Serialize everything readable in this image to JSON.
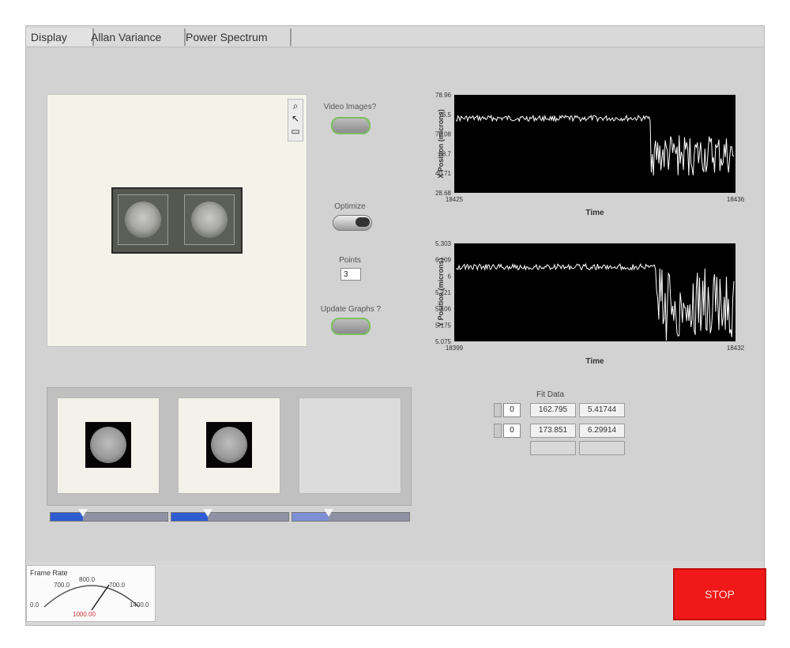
{
  "tabs": [
    {
      "label": "Display",
      "active": true
    },
    {
      "label": "Allan Variance",
      "active": false
    },
    {
      "label": "Power Spectrum",
      "active": false
    }
  ],
  "image_panel": {
    "tools": [
      "zoom-icon",
      "pointer-icon",
      "pan-icon"
    ]
  },
  "controls": {
    "video_images_label": "Video Images?",
    "optimize_label": "Optimize",
    "points_label": "Points",
    "points_value": "3",
    "update_graphs_label": "Update Graphs ?"
  },
  "chart_data": [
    {
      "type": "line",
      "title": "",
      "xlabel": "Time",
      "ylabel": "X Position (microns)",
      "x_tick_labels": [
        "18425",
        "18436"
      ],
      "y_tick_labels": [
        "28.68",
        "40.71",
        "58.7",
        "70.08",
        "76.5",
        "78.96"
      ],
      "grid": false,
      "background": "#000000",
      "line_color": "#ffffff"
    },
    {
      "type": "line",
      "title": "",
      "xlabel": "Time",
      "ylabel": "Y Position (microns)",
      "x_tick_labels": [
        "18399",
        "18432"
      ],
      "y_tick_labels": [
        "5.075",
        "5.175",
        "5.106",
        "5.221",
        "6",
        "6.109",
        "5.303"
      ],
      "grid": false,
      "background": "#000000",
      "line_color": "#ffffff"
    }
  ],
  "fit_table": {
    "title": "Fit Data",
    "rows": [
      {
        "index": "0",
        "values": [
          "162.795",
          "5.41744"
        ]
      },
      {
        "index": "0",
        "values": [
          "173.851",
          "6.29914"
        ]
      }
    ]
  },
  "thumbnails": [
    {
      "state": "image",
      "slider_fraction": 0.28
    },
    {
      "state": "image",
      "slider_fraction": 0.31
    },
    {
      "state": "empty",
      "slider_fraction": 0.31
    }
  ],
  "gauge": {
    "title": "Frame Rate",
    "ticks": [
      "0.0",
      "700.0",
      "800.0",
      "700.0",
      "1400.0"
    ],
    "value": "1000.00"
  },
  "stop_button": {
    "label": "STOP"
  },
  "colors": {
    "stop": "#f01818",
    "accent_green": "#7bbf5f",
    "slider_blue": "#2f5cd0"
  }
}
